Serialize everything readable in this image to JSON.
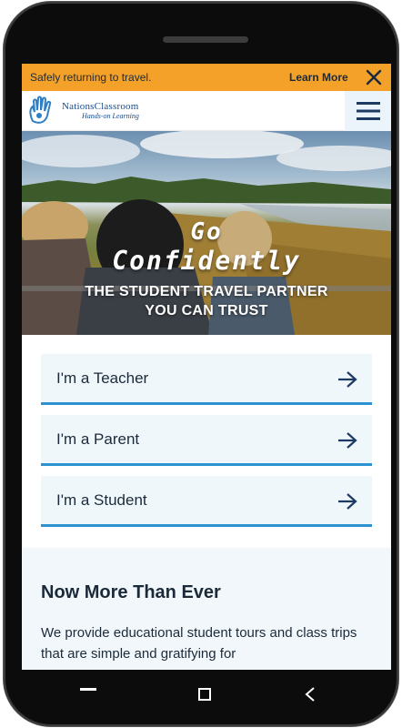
{
  "announcement": {
    "text": "Safely returning to travel.",
    "link_label": "Learn More",
    "close_icon": "close-icon"
  },
  "header": {
    "logo_name": "NationsClassroom",
    "logo_tagline": "Hands-on Learning",
    "menu_icon": "hamburger-menu-icon"
  },
  "hero": {
    "title_line1": "Go",
    "title_line2": "Confidently",
    "subtitle_line1": "THE STUDENT TRAVEL PARTNER",
    "subtitle_line2": "YOU CAN TRUST"
  },
  "roles": [
    {
      "label": "I'm a Teacher",
      "icon": "arrow-right-icon"
    },
    {
      "label": "I'm a Parent",
      "icon": "arrow-right-icon"
    },
    {
      "label": "I'm a Student",
      "icon": "arrow-right-icon"
    }
  ],
  "info": {
    "title": "Now More Than Ever",
    "body": "We provide educational student tours and class trips that are simple and gratifying for"
  },
  "colors": {
    "announcement_bg": "#f4a12a",
    "accent_blue": "#2b93d1",
    "text_dark": "#1b2a3a",
    "card_bg": "#eff7fb"
  }
}
